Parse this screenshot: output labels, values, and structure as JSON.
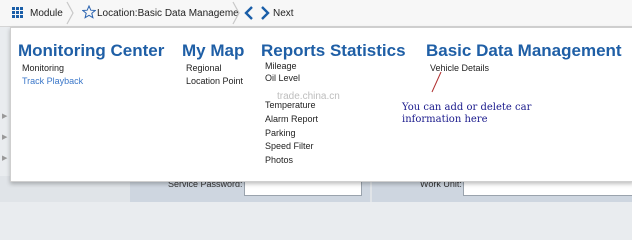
{
  "toolbar": {
    "module_label": "Module",
    "location_label": "Location:Basic Data Manageme",
    "next_label": "Next"
  },
  "menu": {
    "columns": [
      {
        "title": "Monitoring Center",
        "items": [
          "Monitoring",
          "Track Playback"
        ]
      },
      {
        "title": "My Map",
        "items": [
          "Regional",
          "Location Point"
        ]
      },
      {
        "title": "Reports Statistics",
        "items": [
          "Mileage",
          "Oil Level",
          "Temperature",
          "Alarm Report",
          "Parking",
          "Speed Filter",
          "Photos"
        ]
      },
      {
        "title": "Basic Data Management",
        "items": [
          "Vehicle Details"
        ]
      }
    ],
    "watermark": "trade.china.cn",
    "annotation": "You can add or delete car\ninformation here"
  },
  "background_form": {
    "service_password_label": "Service Password:",
    "work_unit_label": "Work Unit:"
  },
  "colors": {
    "accent": "#1f5fa6",
    "link": "#3b77c9",
    "annotation": "#1a1a8c"
  }
}
